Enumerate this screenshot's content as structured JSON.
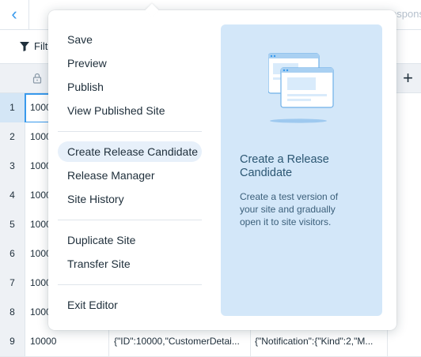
{
  "background": {
    "back_icon": "chevron-left-icon",
    "top_faded_text": "...  ...  ...  ...  Respons",
    "toolbar": {
      "filter_label": "Filte"
    },
    "header": {
      "add_column_label": "+"
    },
    "rows": [
      {
        "num": "1",
        "id": "1000",
        "selected": true
      },
      {
        "num": "2",
        "id": "1000"
      },
      {
        "num": "3",
        "id": "1000"
      },
      {
        "num": "4",
        "id": "1000"
      },
      {
        "num": "5",
        "id": "1000"
      },
      {
        "num": "6",
        "id": "1000"
      },
      {
        "num": "7",
        "id": "1000"
      },
      {
        "num": "8",
        "id": "1000"
      },
      {
        "num": "9",
        "id": "10000",
        "col2": "{\"ID\":10000,\"CustomerDetai...",
        "col3": "{\"Notification\":{\"Kind\":2,\"M..."
      }
    ]
  },
  "menu": {
    "group1": [
      "Save",
      "Preview",
      "Publish",
      "View Published Site"
    ],
    "group2": [
      "Create Release Candidate",
      "Release Manager",
      "Site History"
    ],
    "group3": [
      "Duplicate Site",
      "Transfer Site"
    ],
    "group4": [
      "Exit Editor"
    ],
    "highlighted": "Create Release Candidate"
  },
  "preview": {
    "title": "Create a Release Candidate",
    "description": "Create a test version of your site and gradually open it to site visitors."
  },
  "colors": {
    "accent": "#3899ec",
    "preview_bg": "#d3e7f9",
    "highlight_bg": "#e7f0fa",
    "text": "#20303c"
  }
}
